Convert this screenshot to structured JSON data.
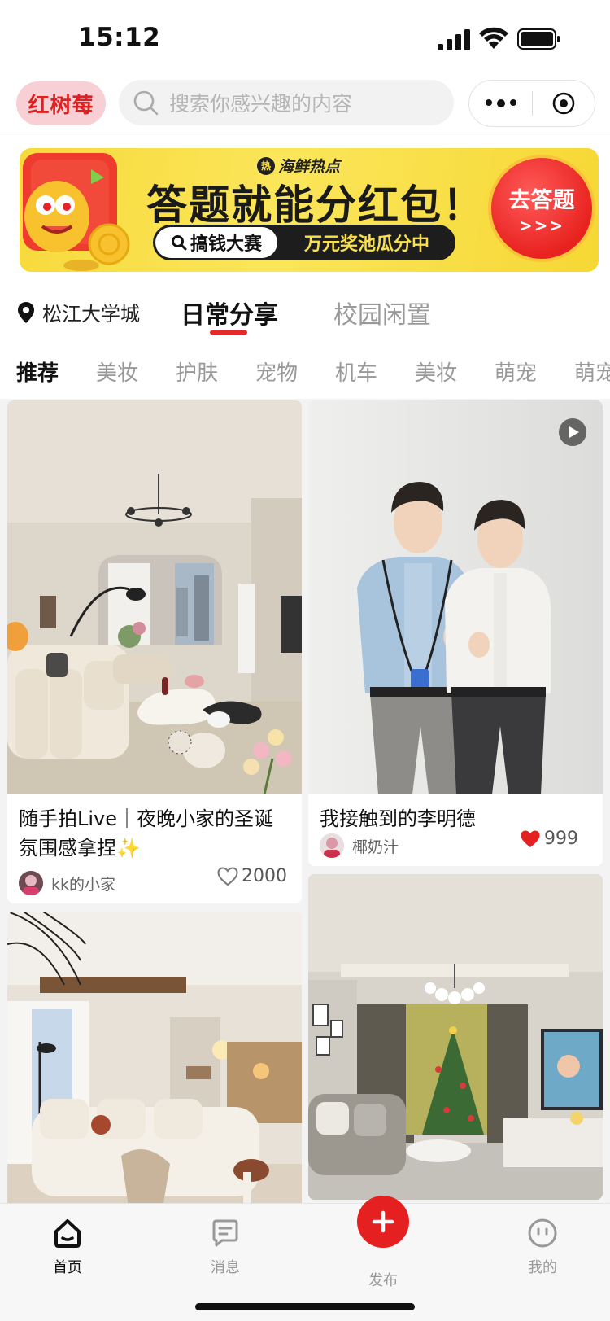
{
  "status_bar": {
    "time": "15:12"
  },
  "top_bar": {
    "logo_text": "红树莓",
    "search_placeholder": "搜索你感兴趣的内容"
  },
  "banner": {
    "brand": "海鲜热点",
    "headline": "答题就能分红包！",
    "pill_left": "搞钱大赛",
    "pill_right": "万元奖池瓜分中",
    "cta_label": "去答题",
    "cta_arrows": ">>>"
  },
  "channel_row": {
    "location": "松江大学城",
    "tabs": [
      {
        "label": "日常分享",
        "active": true
      },
      {
        "label": "校园闲置",
        "active": false
      }
    ]
  },
  "categories": [
    "推荐",
    "美妆",
    "护肤",
    "宠物",
    "机车",
    "美妆",
    "萌宠",
    "萌宠"
  ],
  "active_category": "推荐",
  "feed": {
    "cards": [
      {
        "title": "随手拍Live｜夜晚小家的圣诞氛围感拿捏✨",
        "author": "kk的小家",
        "likes": "2000",
        "liked": false,
        "video": false,
        "image_icon": "living-room-photo"
      },
      {
        "title": "我接触到的李明德",
        "author": "椰奶汁",
        "likes": "999",
        "liked": true,
        "video": true,
        "image_icon": "two-men-photo"
      },
      {
        "title": "",
        "author": "",
        "likes": "",
        "liked": false,
        "video": false,
        "image_icon": "bright-living-room-photo"
      },
      {
        "title": "",
        "author": "",
        "likes": "",
        "liked": false,
        "video": false,
        "image_icon": "christmas-living-room-photo"
      }
    ]
  },
  "bottom_nav": {
    "items": [
      {
        "label": "首页",
        "icon": "home-icon",
        "active": true
      },
      {
        "label": "消息",
        "icon": "message-icon",
        "active": false
      },
      {
        "label": "发布",
        "icon": "plus-icon",
        "active": false
      },
      {
        "label": "我的",
        "icon": "profile-icon",
        "active": false
      }
    ]
  },
  "colors": {
    "accent": "#e52020",
    "banner_yellow": "#f9df3b",
    "text_primary": "#111111",
    "text_secondary": "#999999"
  }
}
